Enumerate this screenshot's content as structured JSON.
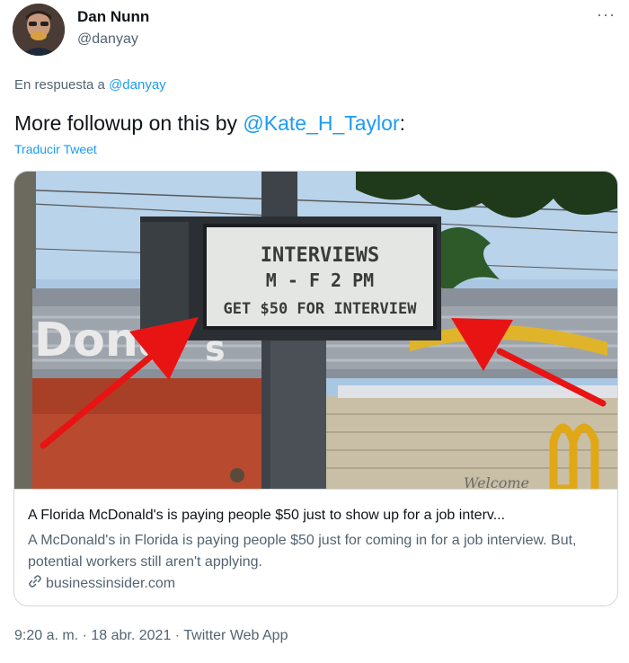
{
  "author": {
    "name": "Dan Nunn",
    "handle": "@danyay"
  },
  "more_icon": "···",
  "reply": {
    "prefix": "En respuesta a",
    "handle": "@danyay"
  },
  "tweet": {
    "text_before": "More followup on this by ",
    "mention": "@Kate_H_Taylor",
    "text_after": ":",
    "translate_label": "Traducir Tweet"
  },
  "card": {
    "sign_line1": "INTERVIEWS",
    "sign_line2": "M - F 2 PM",
    "sign_line3": "GET $50 FOR INTERVIEW",
    "building_text": "Dona",
    "building_text2": "s",
    "welcome_text": "Welcome",
    "title": "A Florida McDonald's is paying people $50 just to show up for a job interv...",
    "description": "A McDonald's in Florida is paying people $50 just for coming in for a job interview. But, potential workers still aren't applying.",
    "domain": "businessinsider.com"
  },
  "meta": {
    "timestamp": "9:20 a. m. · 18 abr. 2021 · Twitter Web App"
  },
  "colors": {
    "link": "#1d9bf0",
    "secondary": "#536471",
    "arrow": "#e81414"
  }
}
